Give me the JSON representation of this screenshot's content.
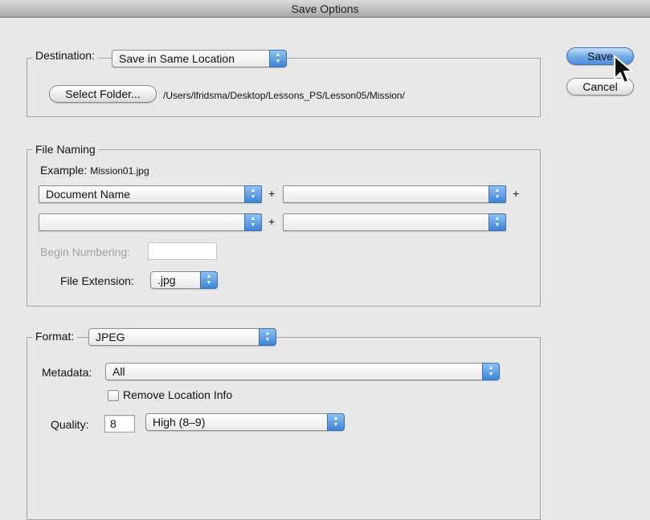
{
  "window": {
    "title": "Save Options"
  },
  "destination": {
    "label": "Destination:",
    "selected": "Save in Same Location",
    "select_folder_label": "Select Folder...",
    "path": "/Users/lfridsma/Desktop/Lessons_PS/Lesson05/Mission/"
  },
  "file_naming": {
    "legend": "File Naming",
    "example_label": "Example:",
    "example_value": "Mission01.jpg",
    "fields": [
      "Document Name",
      "",
      "",
      ""
    ],
    "plus": "+",
    "begin_numbering_label": "Begin Numbering:",
    "begin_numbering_value": "",
    "file_extension_label": "File Extension:",
    "file_extension_value": ".jpg"
  },
  "format": {
    "label": "Format:",
    "selected": "JPEG",
    "metadata_label": "Metadata:",
    "metadata_value": "All",
    "remove_location_label": "Remove Location Info",
    "remove_location_checked": false,
    "quality_label": "Quality:",
    "quality_value": "8",
    "quality_preset": "High  (8–9)"
  },
  "buttons": {
    "save": "Save",
    "cancel": "Cancel"
  },
  "colors": {
    "accent": "#4d8fdc"
  }
}
